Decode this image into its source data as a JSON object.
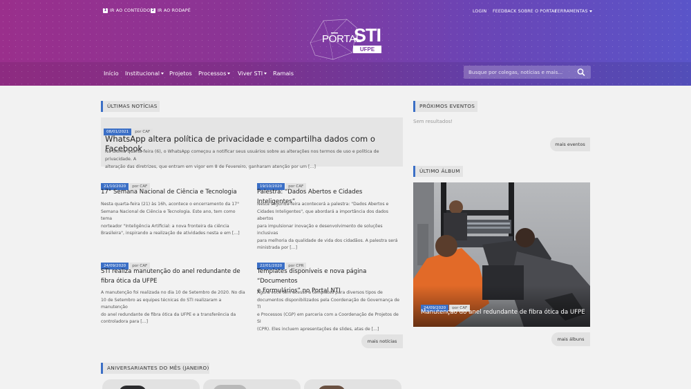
{
  "header": {
    "skip_links": [
      {
        "num": "1",
        "label": "IR AO CONTEÚDO"
      },
      {
        "num": "2",
        "label": "IR AO RODAPÉ"
      }
    ],
    "top_links": {
      "login": "LOGIN",
      "feedback": "FEEDBACK SOBRE O PORTAL",
      "tools": "FERRAMENTAS"
    },
    "logo": {
      "portal": "PORTAL",
      "sti": "STI",
      "ufpe": "UFPE"
    },
    "nav": {
      "inicio": "Início",
      "institucional": "Institucional",
      "projetos": "Projetos",
      "processos": "Processos",
      "viver": "Viver STI",
      "ramais": "Ramais"
    },
    "search_placeholder": "Busque por colegas, notícias e mais..."
  },
  "news_section": {
    "title": "ÚLTIMAS NOTÍCIAS",
    "featured": {
      "date": "08/01/2021",
      "author": "por CAF",
      "title": "WhatsApp altera política de privacidade e compartilha dados com o Facebook",
      "excerpt_1": "Na última quarta-feira (6), o WhatsApp começou a notificar seus usuários sobre as alterações nos termos de uso e política de privacidade. A",
      "excerpt_2": "alteração das diretrizes, que entram em vigor em 8 de Fevereiro, ganharam atenção por um [...]"
    },
    "items": [
      {
        "date": "21/10/2020",
        "author": "por CAF",
        "title": "17° Semana Nacional de Ciência e Tecnologia",
        "lines": [
          "Nesta quarta-feira (21) às 16h, acontece o encerramento da 17°",
          "Semana Nacional de Ciência e Tecnologia. Este ano, tem como tema",
          "norteador \"Inteligência Artificial: a nova fronteira da ciência",
          "Brasileira\", inspirando a realização de atividades nesta e em [...]"
        ]
      },
      {
        "date": "19/10/2020",
        "author": "por CAF",
        "title": "Palestra: “Dados Abertos e Cidades Inteligentes”",
        "lines": [
          "Nesta segunda-feira acontecerá a palestra: \"Dados Abertos e",
          "Cidades Inteligentes\",  que abordará a importância dos dados abertos",
          "para impulsionar  inovação e desenvolvimento de soluções inclusivas",
          "para melhoria da qualidade de vida dos cidadãos. A palestra será",
          "ministrada por [...]"
        ]
      },
      {
        "date": "24/09/2020",
        "author": "por CAF",
        "title_1": "STI realiza manutenção do anel redundante de",
        "title_2": "fibra ótica da UFPE",
        "lines": [
          "A manutenção foi realizada no dia 10 de Setembro de 2020. No dia",
          "10 de Setembro as equipes técnicas do STI realizaram a manutenção",
          "do anel redundante de fibra ótica da UFPE e a transferência da",
          "controladora para [...]"
        ]
      },
      {
        "date": "22/01/2020",
        "author": "por CPR",
        "title_1": "Templates disponíveis e nova página “Documentos",
        "title_2": "e Formulários” no Portal NTI",
        "lines": [
          "Agora você tem acesso a templates para diversos tipos de",
          "documentos disponibilizados pela Coordenação de Governança de TI",
          "e Processos (CGP) em parceria com a Coordenação de Projetos de SI",
          "(CPR). Eles incluem apresentações de slides, atas de [...]"
        ]
      }
    ],
    "more_label": "mais notícias"
  },
  "events_section": {
    "title": "PRÓXIMOS EVENTOS",
    "empty": "Sem resultados!",
    "more_label": "mais eventos"
  },
  "album_section": {
    "title": "ÚLTIMO ÁLBUM",
    "date": "24/09/2020",
    "author": "por CAF",
    "caption": "Manutenção do anel redundante de fibra ótica da UFPE",
    "more_label": "mais álbuns"
  },
  "birthday_section": {
    "title": "ANIVERSARIANTES DO MÊS (JANEIRO)"
  },
  "colors": {
    "accent": "#3b6fc6",
    "header_start": "#9a2f8c",
    "header_end": "#5a55c9"
  },
  "icons": [
    "search-icon",
    "caret-down-icon"
  ]
}
